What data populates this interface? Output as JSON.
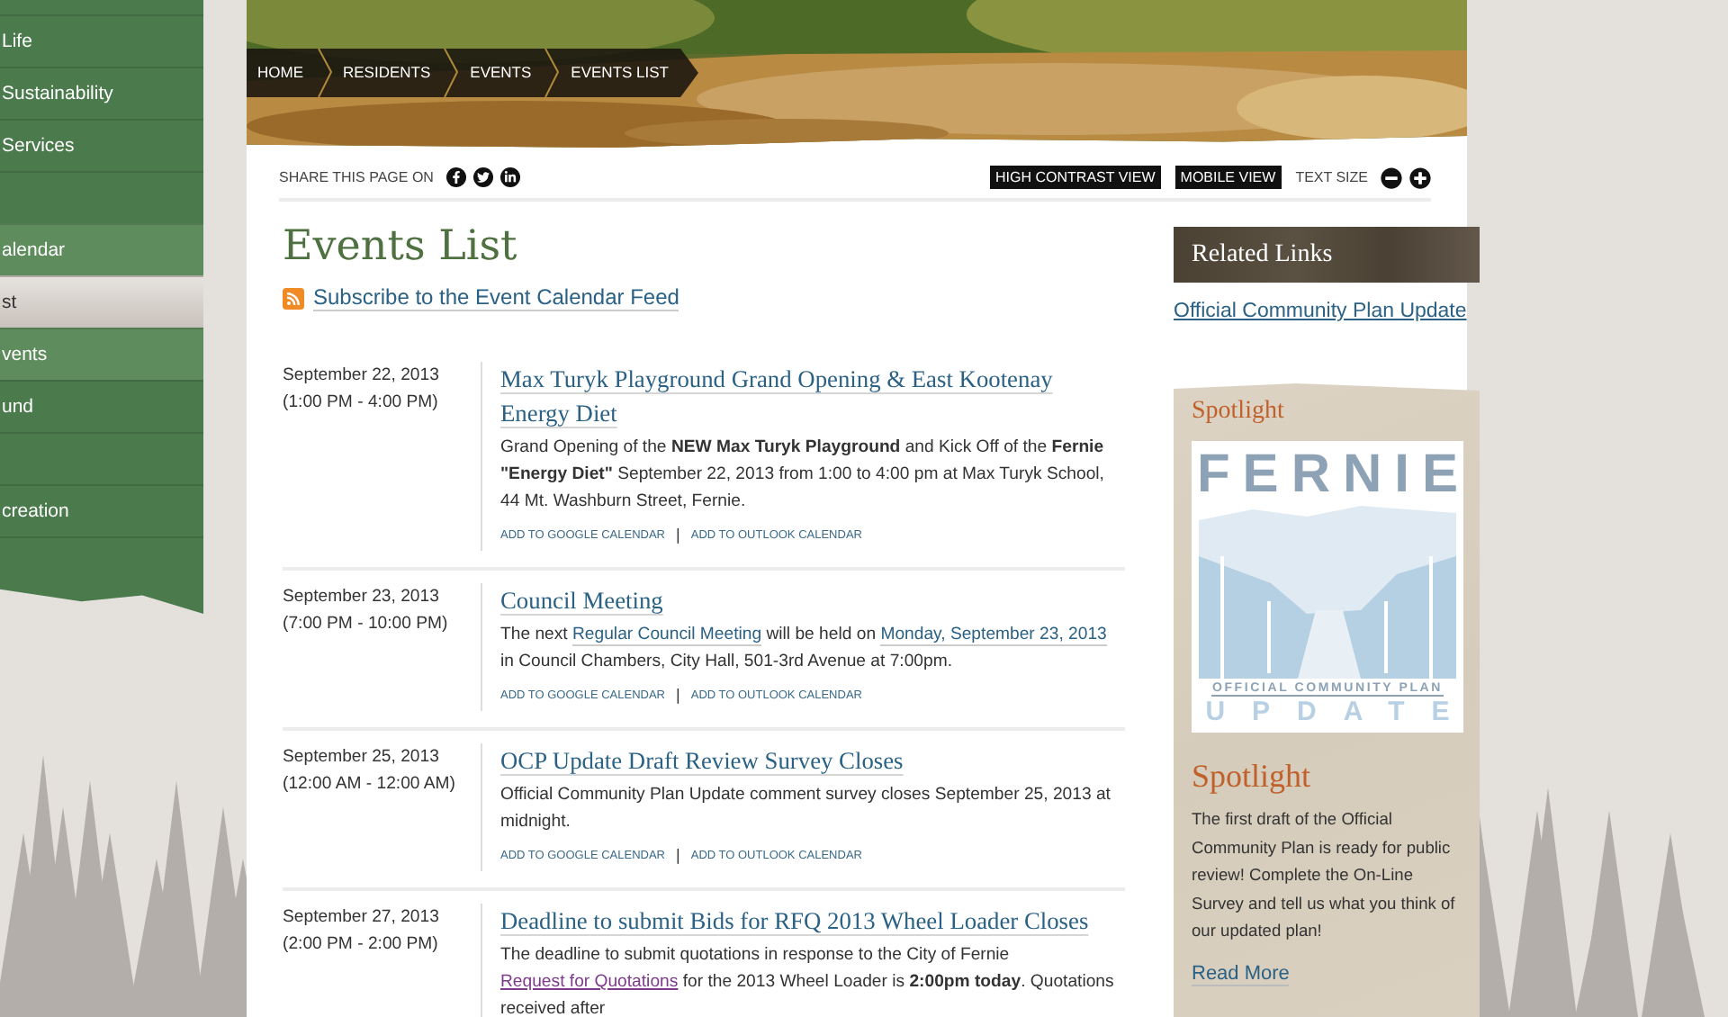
{
  "sidebar": {
    "items": [
      {
        "kind": "link",
        "label": "Life",
        "section": false,
        "selected": false
      },
      {
        "kind": "link",
        "label": "Sustainability",
        "section": false,
        "selected": false
      },
      {
        "kind": "link",
        "label": "Services",
        "section": false,
        "selected": false
      },
      {
        "kind": "blank"
      },
      {
        "kind": "link",
        "label": "alendar",
        "section": true,
        "selected": false
      },
      {
        "kind": "link",
        "label": "st",
        "section": true,
        "selected": true
      },
      {
        "kind": "link",
        "label": "vents",
        "section": true,
        "selected": false
      },
      {
        "kind": "link",
        "label": "und",
        "section": false,
        "selected": false
      },
      {
        "kind": "blank"
      },
      {
        "kind": "link",
        "label": "creation",
        "section": false,
        "selected": false
      },
      {
        "kind": "blank"
      }
    ]
  },
  "hero": {
    "kind": "picture",
    "breadcrumb": [
      {
        "label": "HOME"
      },
      {
        "label": "RESIDENTS"
      },
      {
        "label": "EVENTS"
      },
      {
        "label": "EVENTS LIST"
      }
    ]
  },
  "share": {
    "label": "SHARE THIS PAGE ON"
  },
  "toolbar": {
    "buttons": [
      "HIGH CONTRAST VIEW",
      "MOBILE VIEW"
    ],
    "text_size_label": "TEXT SIZE"
  },
  "page_title": "Events List",
  "feed_link": "Subscribe to the Event Calendar Feed",
  "events": [
    {
      "date": "September 22, 2013",
      "time": "(1:00 PM - 4:00 PM)",
      "title": "Max Turyk Playground Grand Opening & East Kootenay Energy Diet",
      "description": [
        {
          "kind": "text",
          "text": "Grand Opening of the **NEW Max Turyk Playground** and Kick Off of the **Fernie \"Energy Diet\"** September 22, 2013 from 1:00 to 4:00 pm at Max Turyk School, 44 Mt. Washburn Street, Fernie."
        }
      ],
      "links": [
        "ADD TO GOOGLE CALENDAR",
        "ADD TO OUTLOOK CALENDAR"
      ],
      "separator": "|"
    },
    {
      "date": "September 23, 2013",
      "time": "(7:00 PM - 10:00 PM)",
      "title": "Council Meeting",
      "description": [
        {
          "kind": "text",
          "text": "The next "
        },
        {
          "kind": "link",
          "text": "Regular Council Meeting",
          "visited": false
        },
        {
          "kind": "text",
          "text": " will be held on "
        },
        {
          "kind": "link",
          "text": "Monday, September 23, 2013",
          "visited": false
        },
        {
          "kind": "text",
          "text": " in Council Chambers, City Hall, 501-3rd Avenue at 7:00pm."
        }
      ],
      "links": [
        "ADD TO GOOGLE CALENDAR",
        "ADD TO OUTLOOK CALENDAR"
      ],
      "separator": "|"
    },
    {
      "date": "September 25, 2013",
      "time": "(12:00 AM - 12:00 AM)",
      "title": "OCP Update Draft Review Survey Closes",
      "description": [
        {
          "kind": "text",
          "text": "Official Community Plan Update comment survey closes September 25, 2013 at midnight."
        }
      ],
      "links": [
        "ADD TO GOOGLE CALENDAR",
        "ADD TO OUTLOOK CALENDAR"
      ],
      "separator": "|"
    },
    {
      "date": "September 27, 2013",
      "time": "(2:00 PM - 2:00 PM)",
      "title": "Deadline to submit Bids for RFQ 2013 Wheel Loader Closes",
      "description": [
        {
          "kind": "text",
          "text": "The deadline to submit quotations in response to the City of Fernie "
        },
        {
          "kind": "link",
          "text": "Request for Quotations",
          "visited": true
        },
        {
          "kind": "text",
          "text": " for the 2013 Wheel Loader is **2:00pm today**. Quotations received after"
        }
      ]
    }
  ],
  "related_links": {
    "title": "Related Links",
    "links": [
      "Official Community Plan Update"
    ]
  },
  "spotlight": {
    "title": "Spotlight",
    "logo": {
      "name": "FERNIE",
      "subtitle": "OFFICIAL COMMUNITY PLAN",
      "tagline": "UPDATE"
    },
    "heading": "Spotlight",
    "text": "The first draft of the Official Community Plan is ready for public review! Complete the On-Line Survey and tell us what you think of our updated plan!",
    "link": "Read More"
  }
}
